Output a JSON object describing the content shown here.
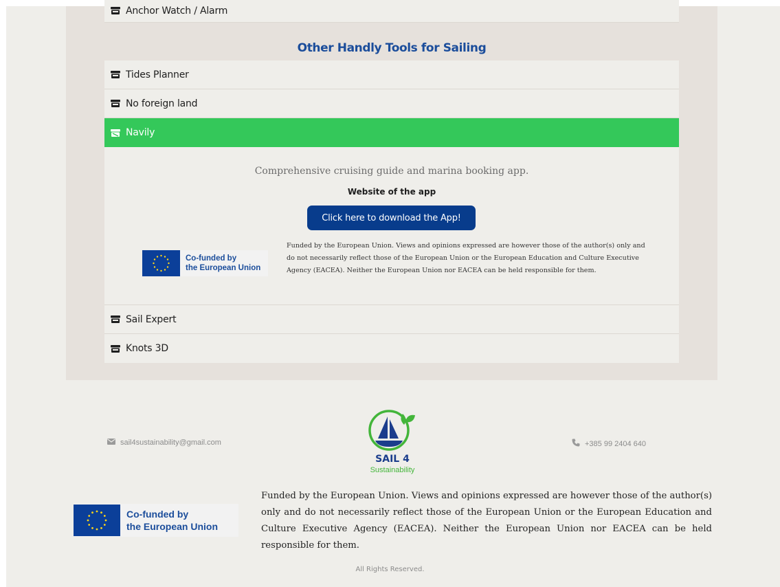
{
  "accordion_top": {
    "label": "Anchor Watch / Alarm"
  },
  "section": {
    "title": "Other Handly Tools for Sailing"
  },
  "accordion": [
    {
      "label": "Tides Planner"
    },
    {
      "label": "No foreign land"
    },
    {
      "label": "Navily",
      "active": true
    },
    {
      "label": "Sail Expert"
    },
    {
      "label": "Knots 3D"
    }
  ],
  "navily": {
    "description": "Comprehensive cruising guide and marina booking app.",
    "website_label": "Website of the app",
    "download_button": "Click here to download the App!",
    "disclaimer": "Funded by the European Union. Views and opinions expressed are however those of the author(s) only and do not necessarily reflect those of the European Union or the European Education and Culture Executive Agency (EACEA). Neither the European Union nor EACEA can be held responsible for them."
  },
  "eu_logo": {
    "line1": "Co-funded by",
    "line2": "the European Union"
  },
  "footer": {
    "email": "sail4sustainability@gmail.com",
    "phone": "+385 99 2404 640",
    "logo_title": "SAIL 4",
    "logo_subtitle": "Sustainability",
    "disclaimer": "Funded by the European Union. Views and opinions expressed are however those of the author(s) only and do not necessarily reflect those of the European Union or the European Education and Culture Executive Agency (EACEA). Neither the European Union nor EACEA can be held responsible for them.",
    "rights": "All Rights Reserved."
  },
  "colors": {
    "accent_green": "#34c85a",
    "brand_blue": "#083c8c",
    "title_blue": "#1b4d9b",
    "panel_bg": "#e6e1dc",
    "page_bg": "#efeeea"
  },
  "icons": {
    "accordion": "store-icon",
    "email": "envelope-icon",
    "phone": "phone-icon"
  }
}
